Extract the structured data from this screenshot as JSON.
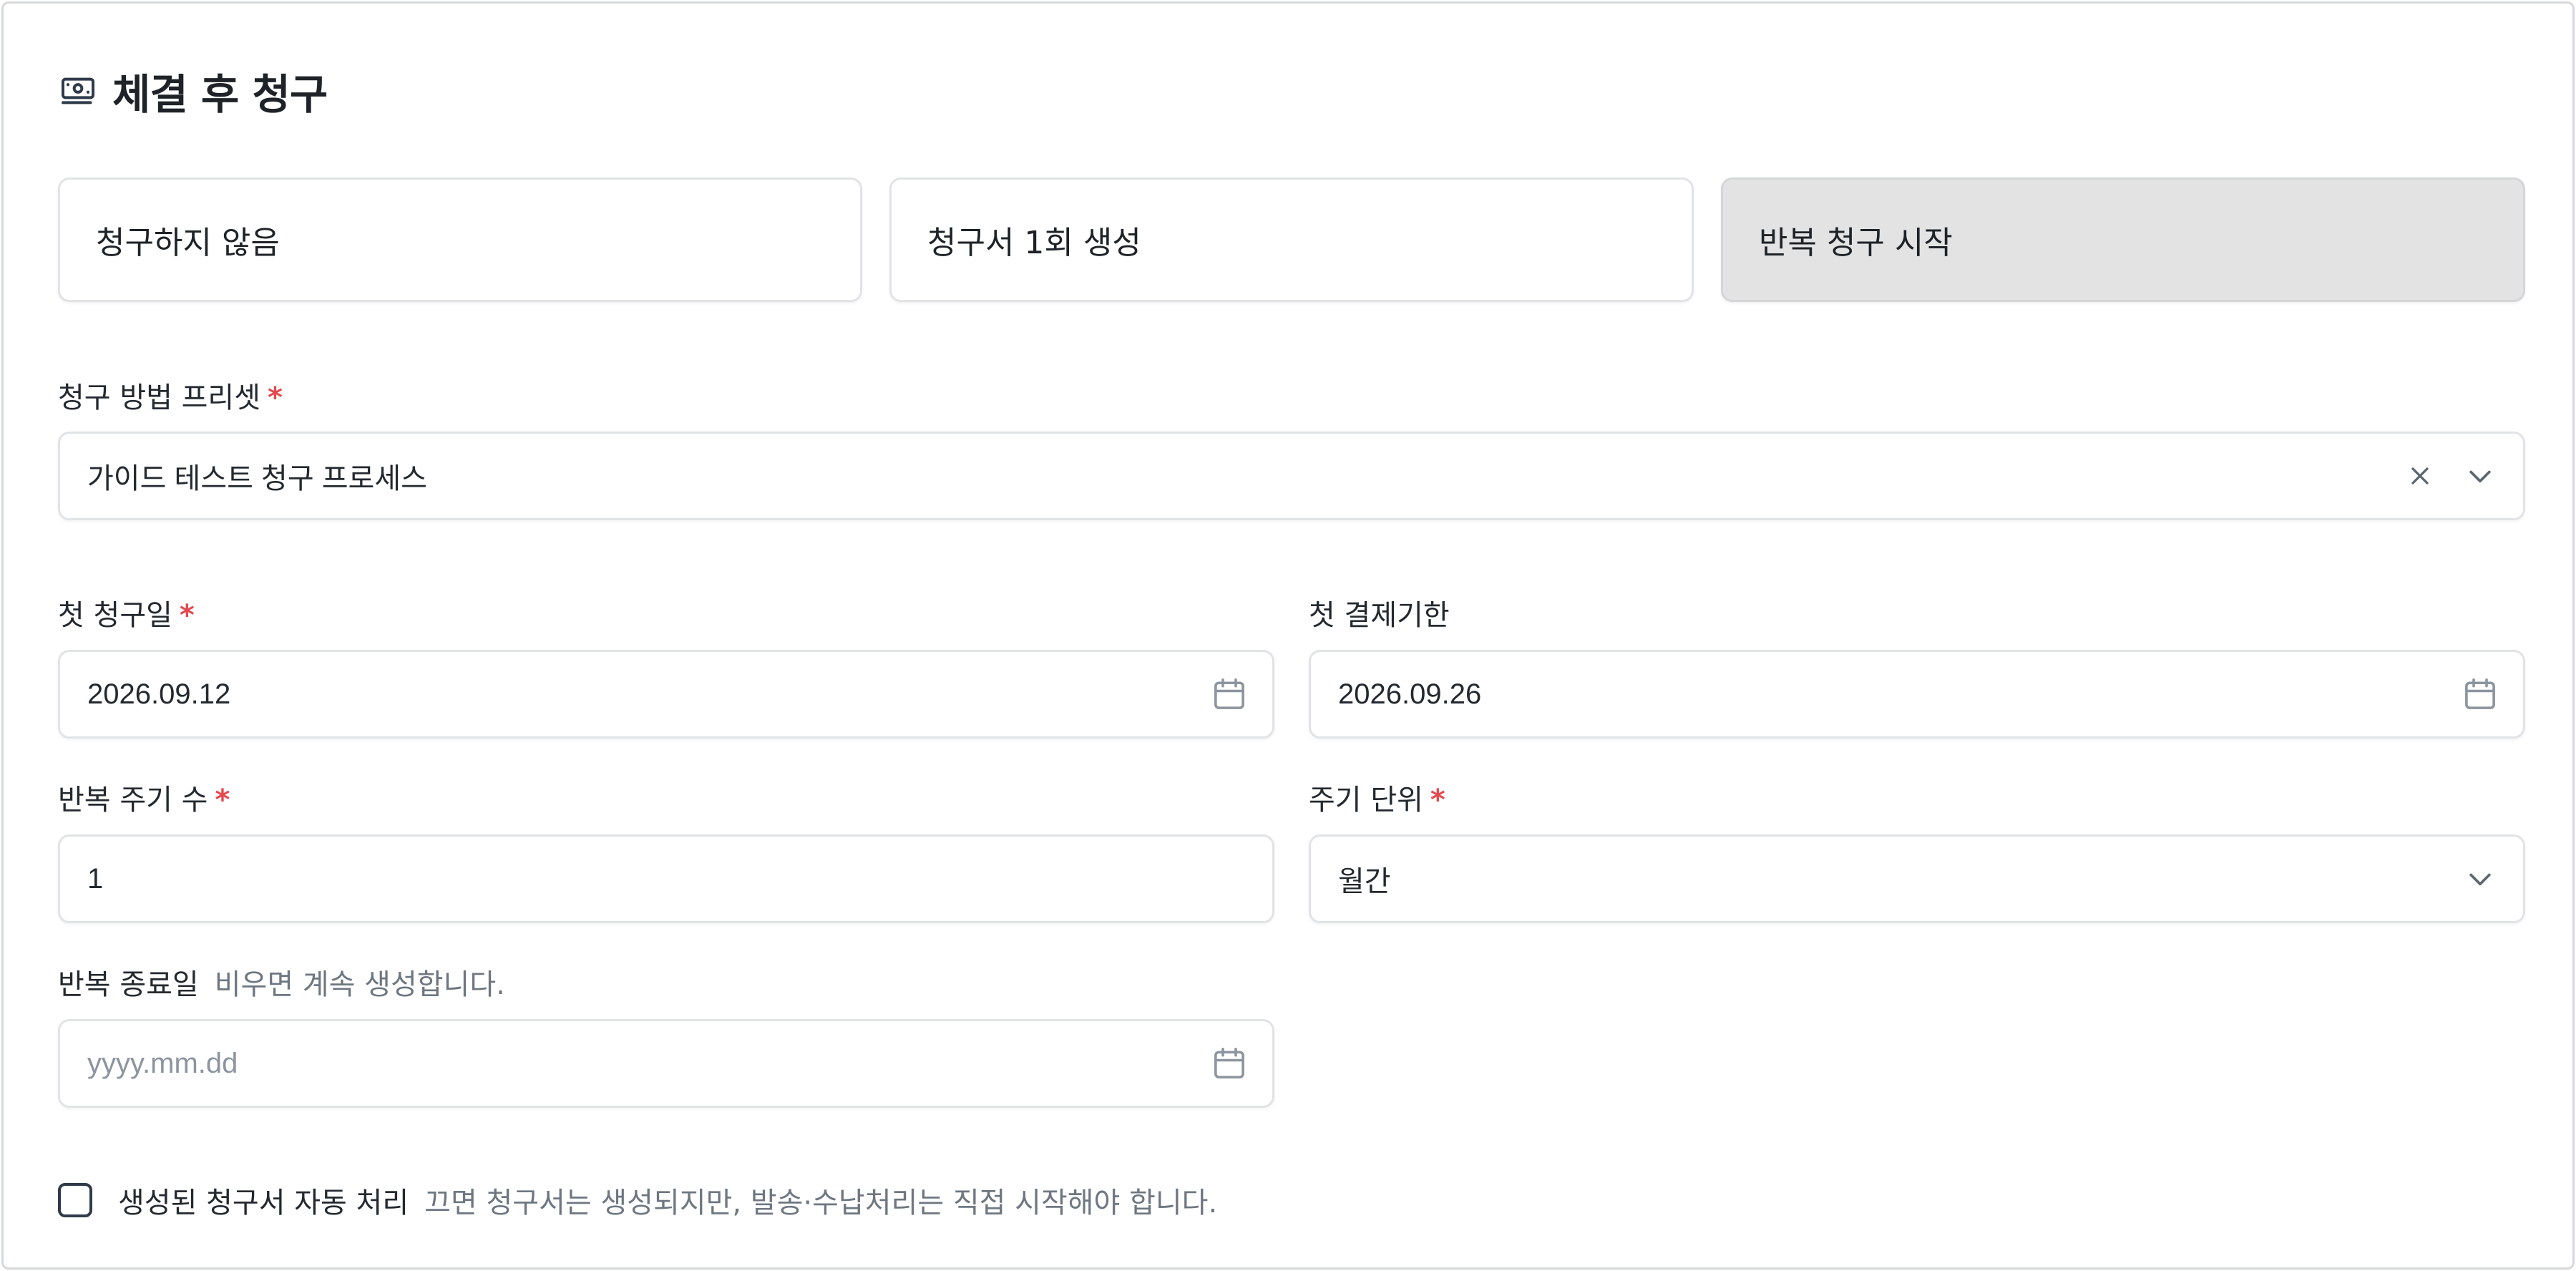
{
  "header": {
    "title": "체결 후 청구",
    "icon": "money-bill-icon"
  },
  "billing_options": [
    {
      "label": "청구하지 않음",
      "selected": false
    },
    {
      "label": "청구서 1회 생성",
      "selected": false
    },
    {
      "label": "반복 청구 시작",
      "selected": true
    }
  ],
  "preset": {
    "label": "청구 방법 프리셋",
    "required_mark": "*",
    "value": "가이드 테스트 청구 프로세스"
  },
  "first_billing_date": {
    "label": "첫 청구일",
    "required_mark": "*",
    "value": "2026.09.12"
  },
  "first_due_date": {
    "label": "첫 결제기한",
    "value": "2026.09.26"
  },
  "cycle_count": {
    "label": "반복 주기 수",
    "required_mark": "*",
    "value": "1"
  },
  "cycle_unit": {
    "label": "주기 단위",
    "required_mark": "*",
    "value": "월간"
  },
  "repeat_end_date": {
    "label": "반복 종료일",
    "hint": "비우면 계속 생성합니다.",
    "placeholder": "yyyy.mm.dd"
  },
  "auto_process": {
    "label": "생성된 청구서 자동 처리",
    "hint": "끄면 청구서는 생성되지만, 발송·수납처리는 직접 시작해야 합니다.",
    "checked": false
  },
  "colors": {
    "required": "#e5484d",
    "selected_bg": "#e3e3e3",
    "border": "#e1e3e6"
  }
}
